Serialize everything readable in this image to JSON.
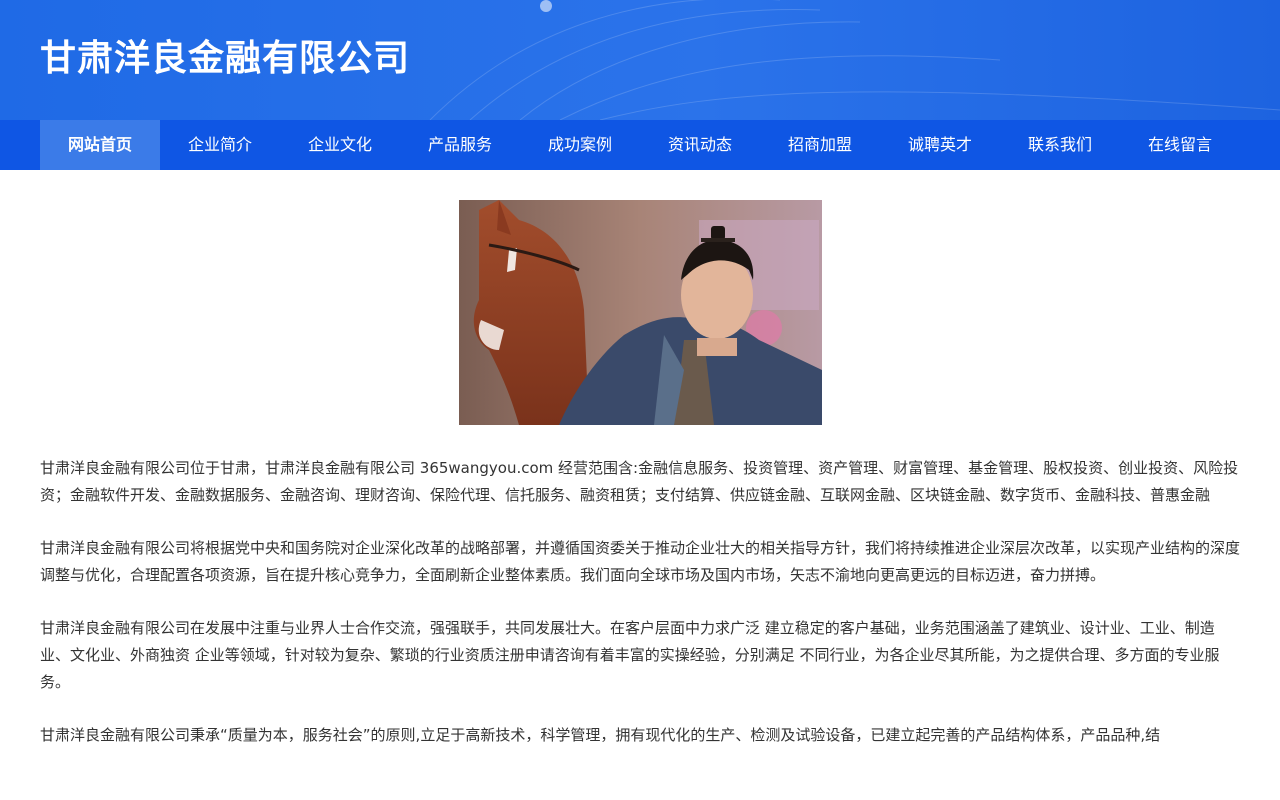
{
  "header": {
    "title": "甘肃洋良金融有限公司"
  },
  "nav": {
    "items": [
      {
        "label": "网站首页"
      },
      {
        "label": "企业简介"
      },
      {
        "label": "企业文化"
      },
      {
        "label": "产品服务"
      },
      {
        "label": "成功案例"
      },
      {
        "label": "资讯动态"
      },
      {
        "label": "招商加盟"
      },
      {
        "label": "诚聘英才"
      },
      {
        "label": "联系我们"
      },
      {
        "label": "在线留言"
      }
    ],
    "active_index": 0
  },
  "main": {
    "image_icon": "horse-and-man-photo",
    "paragraphs": [
      "甘肃洋良金融有限公司位于甘肃，甘肃洋良金融有限公司 365wangyou.com 经营范围含:金融信息服务、投资管理、资产管理、财富管理、基金管理、股权投资、创业投资、风险投资；金融软件开发、金融数据服务、金融咨询、理财咨询、保险代理、信托服务、融资租赁；支付结算、供应链金融、互联网金融、区块链金融、数字货币、金融科技、普惠金融",
      "甘肃洋良金融有限公司将根据党中央和国务院对企业深化改革的战略部署，并遵循国资委关于推动企业壮大的相关指导方针，我们将持续推进企业深层次改革，以实现产业结构的深度调整与优化，合理配置各项资源，旨在提升核心竞争力，全面刷新企业整体素质。我们面向全球市场及国内市场，矢志不渝地向更高更远的目标迈进，奋力拼搏。",
      "甘肃洋良金融有限公司在发展中注重与业界人士合作交流，强强联手，共同发展壮大。在客户层面中力求广泛 建立稳定的客户基础，业务范围涵盖了建筑业、设计业、工业、制造业、文化业、外商独资 企业等领域，针对较为复杂、繁琐的行业资质注册申请咨询有着丰富的实操经验，分别满足 不同行业，为各企业尽其所能，为之提供合理、多方面的专业服务。",
      "甘肃洋良金融有限公司秉承“质量为本，服务社会”的原则,立足于高新技术，科学管理，拥有现代化的生产、检测及试验设备，已建立起完善的产品结构体系，产品品种,结"
    ]
  },
  "colors": {
    "header_bg": "#2b73ea",
    "nav_bg": "#0f56e4",
    "nav_active_bg": "#3b7be8",
    "text": "#333333"
  }
}
